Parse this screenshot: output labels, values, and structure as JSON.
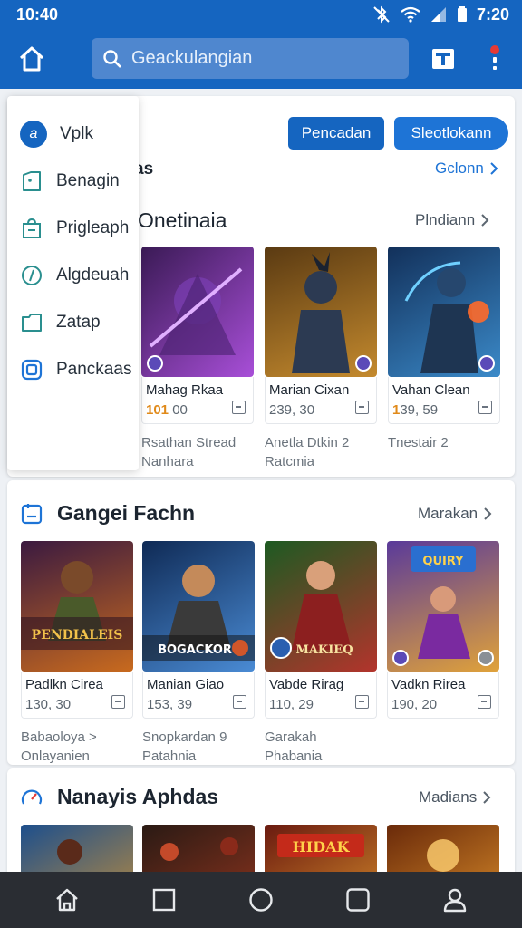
{
  "status_bar": {
    "time_left": "10:40",
    "time_right": "7:20"
  },
  "search": {
    "placeholder": "Geackulangian"
  },
  "menu": {
    "items": [
      {
        "label": "Vplk",
        "icon": "app-logo-icon"
      },
      {
        "label": "Benagin",
        "icon": "tag-icon"
      },
      {
        "label": "Prigleaph",
        "icon": "bag-icon"
      },
      {
        "label": "Algdeuah",
        "icon": "compass-icon"
      },
      {
        "label": "Zatap",
        "icon": "folder-icon"
      },
      {
        "label": "Panckaas",
        "icon": "package-icon"
      }
    ]
  },
  "top_actions": {
    "secondary_label": "Pencadan",
    "primary_label": "Sleotlokann"
  },
  "section1": {
    "title_tail": "as",
    "link": "Gclonn",
    "title": "Onetinaia",
    "more": "Plndiann",
    "tiles": [
      {
        "name": "Mahag Rkaa",
        "price_hl": "101",
        "price": "00",
        "colors": [
          "#3a1a55",
          "#a84fd8"
        ]
      },
      {
        "name": "Marian Cixan",
        "price_hl": "",
        "price": "239, 30",
        "colors": [
          "#5a3a12",
          "#c48a2e"
        ]
      },
      {
        "name": "Vahan Clean",
        "price_hl": "1",
        "price": "39, 59",
        "colors": [
          "#12305a",
          "#3b8ac9"
        ]
      }
    ],
    "sub_left": [
      "Rsathan Stread",
      "Nanhara"
    ],
    "sub_mid": [
      "Anetla Dtkin 2",
      "Ratcmia"
    ],
    "sub_right": [
      "Tnestair 2"
    ]
  },
  "section2": {
    "title": "Gangei Fachn",
    "more": "Marakan",
    "tiles": [
      {
        "name": "Padlkn Cirea",
        "price": "130, 30",
        "art_text": "PENDIALEIS",
        "colors": [
          "#3b1a40",
          "#c86a1e"
        ]
      },
      {
        "name": "Manian Giao",
        "price": "153, 39",
        "art_text": "BOGACKOR",
        "colors": [
          "#0f2a55",
          "#4a8bd4"
        ]
      },
      {
        "name": "Vabde Rirag",
        "price": "110, 29",
        "art_text": "MAKIEQ",
        "colors": [
          "#1d5a22",
          "#b3342c"
        ]
      },
      {
        "name": "Vadkn Rirea",
        "price": "190, 20",
        "art_text": "QUIRY",
        "colors": [
          "#5a3a9a",
          "#e0a23a"
        ]
      }
    ],
    "sub_1": [
      "Babaoloya >",
      "Onlayanien"
    ],
    "sub_2": [
      "Snopkardan 9",
      "Patahnia"
    ],
    "sub_3": [
      "Garakah",
      "Phabania"
    ]
  },
  "section3": {
    "title": "Nanayis Aphdas",
    "more": "Madians",
    "tiles": [
      {
        "colors": [
          "#1d4f8c",
          "#e39b2a"
        ]
      },
      {
        "colors": [
          "#2a1a14",
          "#a63a20"
        ]
      },
      {
        "colors": [
          "#6a1a10",
          "#e8a030"
        ],
        "art_text": "HIDAK"
      },
      {
        "colors": [
          "#6a2a0a",
          "#f0a030"
        ]
      }
    ]
  }
}
